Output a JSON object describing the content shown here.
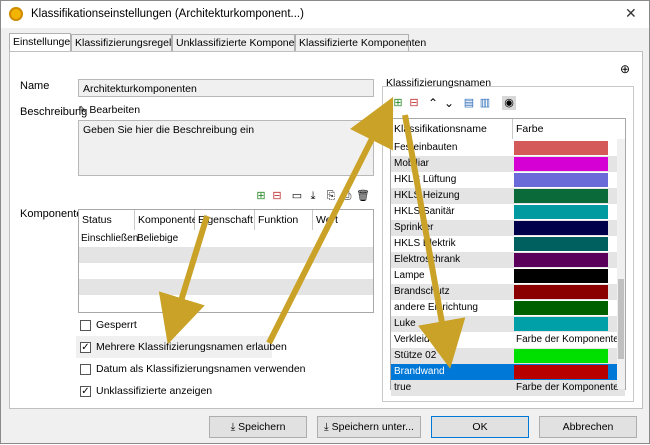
{
  "window": {
    "title": "Klassifikationseinstellungen (Architekturkomponent...)",
    "close_glyph": "✕"
  },
  "tabs": [
    "Einstellungen",
    "Klassifizierungsregeln",
    "Unklassifizierte Komponenten",
    "Klassifizierte Komponenten"
  ],
  "form": {
    "name_label": "Name",
    "name_value": "Architekturkomponenten",
    "desc_label": "Beschreibung",
    "edit_label": "Bearbeiten",
    "desc_text": "Geben Sie hier die Beschreibung ein",
    "components_label": "Komponenten"
  },
  "components_table": {
    "columns": [
      "Status",
      "Komponente",
      "Eigenschaft",
      "Funktion",
      "Wert"
    ],
    "rows": [
      [
        "Einschließen",
        "Beliebige",
        "",
        "",
        ""
      ]
    ]
  },
  "checkboxes": [
    {
      "label": "Gesperrt",
      "checked": false
    },
    {
      "label": "Mehrere Klassifizierungsnamen erlauben",
      "checked": true
    },
    {
      "label": "Datum als Klassifizierungsnamen verwenden",
      "checked": false
    },
    {
      "label": "Unklassifizierte anzeigen",
      "checked": true
    }
  ],
  "classification": {
    "title": "Klassifizierungsnamen",
    "columns": [
      "Klassifikationsname",
      "Farbe"
    ],
    "rows": [
      {
        "name": "Festeinbauten",
        "color": "#d45a5a",
        "color_text": ""
      },
      {
        "name": "Mobiliar",
        "color": "#d400d4",
        "color_text": ""
      },
      {
        "name": "HKLS Lüftung",
        "color": "#6a6ad8",
        "color_text": ""
      },
      {
        "name": "HKLS Heizung",
        "color": "#0a6a3a",
        "color_text": ""
      },
      {
        "name": "HKLS Sanitär",
        "color": "#009aa0",
        "color_text": ""
      },
      {
        "name": "Sprinkler",
        "color": "#00004a",
        "color_text": ""
      },
      {
        "name": "HKLS Elektrik",
        "color": "#006060",
        "color_text": ""
      },
      {
        "name": "Elektroschrank",
        "color": "#5a005a",
        "color_text": ""
      },
      {
        "name": "Lampe",
        "color": "#000000",
        "color_text": ""
      },
      {
        "name": "Brandschutz",
        "color": "#8a0000",
        "color_text": ""
      },
      {
        "name": "andere Einrichtung",
        "color": "#006000",
        "color_text": ""
      },
      {
        "name": "Luke",
        "color": "#00a0a8",
        "color_text": ""
      },
      {
        "name": "Verkleidungen",
        "color": "",
        "color_text": "Farbe der Komponente"
      },
      {
        "name": "Stütze 02",
        "color": "#00e000",
        "color_text": ""
      },
      {
        "name": "Brandwand",
        "color": "#b80000",
        "color_text": "",
        "selected": true
      },
      {
        "name": "true",
        "color": "",
        "color_text": "Farbe der Komponente"
      }
    ]
  },
  "buttons": {
    "save": "Speichern",
    "save_as": "Speichern unter...",
    "ok": "OK",
    "cancel": "Abbrechen"
  },
  "colors": {
    "accent": "#0078d7",
    "annotation_arrow": "#c9a227"
  }
}
